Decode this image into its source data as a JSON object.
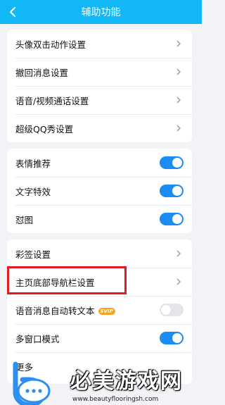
{
  "header": {
    "title": "辅助功能",
    "back_icon": "chevron-left-icon"
  },
  "group1": [
    {
      "label": "头像双击动作设置"
    },
    {
      "label": "撤回消息设置"
    },
    {
      "label": "语音/视频通话设置"
    },
    {
      "label": "超级QQ秀设置"
    }
  ],
  "group2": [
    {
      "label": "表情推荐",
      "toggle": true
    },
    {
      "label": "文字特效",
      "toggle": true
    },
    {
      "label": "怼图",
      "toggle": true
    }
  ],
  "group3": [
    {
      "label": "彩签设置"
    },
    {
      "label": "主页底部导航栏设置"
    },
    {
      "label": "语音消息自动转文本",
      "badge": "SVIP",
      "toggle": false
    },
    {
      "label": "多窗口模式",
      "toggle": true
    },
    {
      "label": "更多"
    }
  ],
  "watermark": {
    "text": "必美游戏网",
    "url": "www.beautyflooringsh.com"
  },
  "colors": {
    "accent": "#12b7f5",
    "toggle_on": "#1a8cf2",
    "highlight": "#e01b24",
    "badge": "#f4a623"
  }
}
